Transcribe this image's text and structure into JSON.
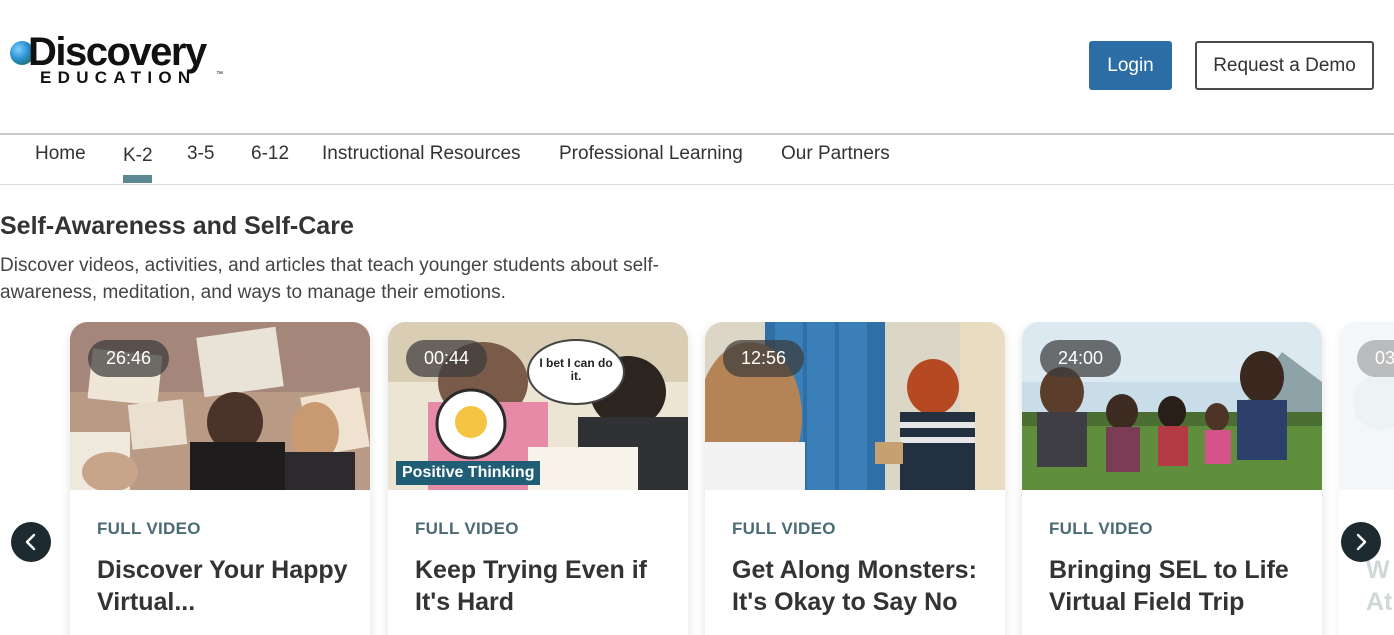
{
  "brand": {
    "name_main": "Discovery",
    "name_sub": "EDUCATION",
    "tm": "™"
  },
  "header": {
    "login_label": "Login",
    "demo_label": "Request a Demo"
  },
  "nav": {
    "items": [
      "Home",
      "K-2",
      "3-5",
      "6-12",
      "Instructional Resources",
      "Professional Learning",
      "Our Partners"
    ],
    "active": "K-2"
  },
  "section": {
    "title": "Self-Awareness and Self-Care",
    "description": "Discover videos, activities, and articles that teach younger students about self-awareness, meditation, and ways to manage their emotions."
  },
  "cards": [
    {
      "duration": "26:46",
      "type": "FULL VIDEO",
      "title": "Discover Your Happy Virtual..."
    },
    {
      "duration": "00:44",
      "type": "FULL VIDEO",
      "title": "Keep Trying Even if It's Hard",
      "overlay_bubble": "I bet I can do it.",
      "overlay_banner": "Positive Thinking"
    },
    {
      "duration": "12:56",
      "type": "FULL VIDEO",
      "title": "Get Along Monsters: It's Okay to Say No"
    },
    {
      "duration": "24:00",
      "type": "FULL VIDEO",
      "title": "Bringing SEL to Life Virtual Field Trip"
    }
  ],
  "partial_card": {
    "duration": "03",
    "title_fragment": "W\nAt"
  },
  "icons": {
    "prev": "chevron-left-icon",
    "next": "chevron-right-icon"
  },
  "colors": {
    "primary": "#2b6da4",
    "accent": "#5e8794",
    "arrow_bg": "#1d2a30",
    "label": "#4b6b73"
  }
}
